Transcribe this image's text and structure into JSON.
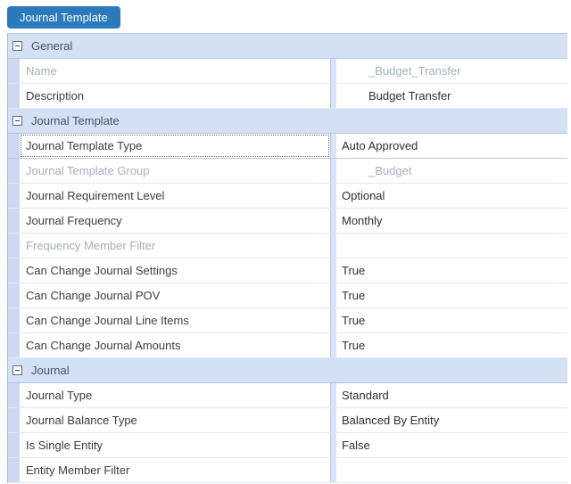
{
  "colors": {
    "accent_blue": "#2b7abc",
    "section_header_bg": "#d4e0f4",
    "section_header_border": "#b3c6e8",
    "section_title_text": "#44546a",
    "row_separator": "#dfe8f7",
    "gutter_bg": "#cdd9f1",
    "label_text": "#3d3d3d",
    "value_text": "#303030",
    "disabled_text": "#a7aeb9"
  },
  "tab": {
    "label": "Journal Template"
  },
  "icons": {
    "section_collapse": "minus-box-collapse-icon"
  },
  "property_grid": {
    "sections": [
      {
        "title": "General",
        "rows": [
          {
            "label": "Name",
            "value": "_Budget_Transfer",
            "label_disabled": true,
            "value_disabled": true,
            "value_indented": true
          },
          {
            "label": "Description",
            "value": "Budget Transfer",
            "value_indented": true
          }
        ]
      },
      {
        "title": "Journal Template",
        "rows": [
          {
            "label": "Journal Template Type",
            "value": "Auto Approved",
            "selected": true
          },
          {
            "label": "Journal Template Group",
            "value": "_Budget",
            "label_disabled": true,
            "value_disabled": true,
            "value_indented": true
          },
          {
            "label": "Journal Requirement Level",
            "value": "Optional"
          },
          {
            "label": "Journal Frequency",
            "value": "Monthly"
          },
          {
            "label": "Frequency Member Filter",
            "value": "",
            "label_disabled": true
          },
          {
            "label": "Can Change Journal Settings",
            "value": "True"
          },
          {
            "label": "Can Change Journal POV",
            "value": "True"
          },
          {
            "label": "Can Change Journal Line Items",
            "value": "True"
          },
          {
            "label": "Can Change Journal Amounts",
            "value": "True"
          }
        ]
      },
      {
        "title": "Journal",
        "rows": [
          {
            "label": "Journal Type",
            "value": "Standard"
          },
          {
            "label": "Journal Balance Type",
            "value": "Balanced By Entity"
          },
          {
            "label": "Is Single Entity",
            "value": "False"
          },
          {
            "label": "Entity Member Filter",
            "value": ""
          }
        ]
      }
    ]
  }
}
